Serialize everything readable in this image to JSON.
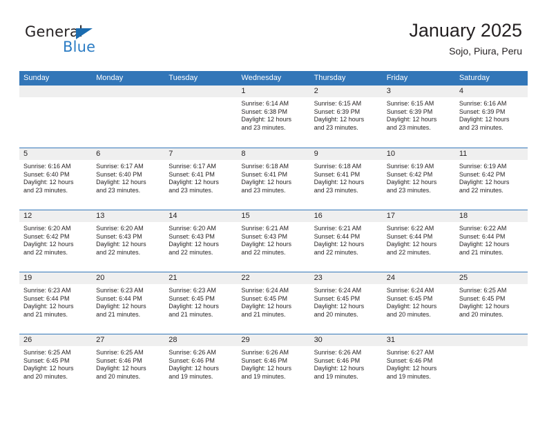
{
  "brand": {
    "name_top": "General",
    "name_bottom": "Blue",
    "accent_color": "#2b7cc4",
    "triangle_color": "#1b6cb0"
  },
  "header": {
    "title": "January 2025",
    "subtitle": "Sojo, Piura, Peru",
    "header_bg": "#3276b8",
    "daynum_bg": "#efefef"
  },
  "weekdays": [
    "Sunday",
    "Monday",
    "Tuesday",
    "Wednesday",
    "Thursday",
    "Friday",
    "Saturday"
  ],
  "weeks": [
    [
      {
        "day": "",
        "sunrise": "",
        "sunset": "",
        "daylight_1": "",
        "daylight_2": ""
      },
      {
        "day": "",
        "sunrise": "",
        "sunset": "",
        "daylight_1": "",
        "daylight_2": ""
      },
      {
        "day": "",
        "sunrise": "",
        "sunset": "",
        "daylight_1": "",
        "daylight_2": ""
      },
      {
        "day": "1",
        "sunrise": "Sunrise: 6:14 AM",
        "sunset": "Sunset: 6:38 PM",
        "daylight_1": "Daylight: 12 hours",
        "daylight_2": "and 23 minutes."
      },
      {
        "day": "2",
        "sunrise": "Sunrise: 6:15 AM",
        "sunset": "Sunset: 6:39 PM",
        "daylight_1": "Daylight: 12 hours",
        "daylight_2": "and 23 minutes."
      },
      {
        "day": "3",
        "sunrise": "Sunrise: 6:15 AM",
        "sunset": "Sunset: 6:39 PM",
        "daylight_1": "Daylight: 12 hours",
        "daylight_2": "and 23 minutes."
      },
      {
        "day": "4",
        "sunrise": "Sunrise: 6:16 AM",
        "sunset": "Sunset: 6:39 PM",
        "daylight_1": "Daylight: 12 hours",
        "daylight_2": "and 23 minutes."
      }
    ],
    [
      {
        "day": "5",
        "sunrise": "Sunrise: 6:16 AM",
        "sunset": "Sunset: 6:40 PM",
        "daylight_1": "Daylight: 12 hours",
        "daylight_2": "and 23 minutes."
      },
      {
        "day": "6",
        "sunrise": "Sunrise: 6:17 AM",
        "sunset": "Sunset: 6:40 PM",
        "daylight_1": "Daylight: 12 hours",
        "daylight_2": "and 23 minutes."
      },
      {
        "day": "7",
        "sunrise": "Sunrise: 6:17 AM",
        "sunset": "Sunset: 6:41 PM",
        "daylight_1": "Daylight: 12 hours",
        "daylight_2": "and 23 minutes."
      },
      {
        "day": "8",
        "sunrise": "Sunrise: 6:18 AM",
        "sunset": "Sunset: 6:41 PM",
        "daylight_1": "Daylight: 12 hours",
        "daylight_2": "and 23 minutes."
      },
      {
        "day": "9",
        "sunrise": "Sunrise: 6:18 AM",
        "sunset": "Sunset: 6:41 PM",
        "daylight_1": "Daylight: 12 hours",
        "daylight_2": "and 23 minutes."
      },
      {
        "day": "10",
        "sunrise": "Sunrise: 6:19 AM",
        "sunset": "Sunset: 6:42 PM",
        "daylight_1": "Daylight: 12 hours",
        "daylight_2": "and 23 minutes."
      },
      {
        "day": "11",
        "sunrise": "Sunrise: 6:19 AM",
        "sunset": "Sunset: 6:42 PM",
        "daylight_1": "Daylight: 12 hours",
        "daylight_2": "and 22 minutes."
      }
    ],
    [
      {
        "day": "12",
        "sunrise": "Sunrise: 6:20 AM",
        "sunset": "Sunset: 6:42 PM",
        "daylight_1": "Daylight: 12 hours",
        "daylight_2": "and 22 minutes."
      },
      {
        "day": "13",
        "sunrise": "Sunrise: 6:20 AM",
        "sunset": "Sunset: 6:43 PM",
        "daylight_1": "Daylight: 12 hours",
        "daylight_2": "and 22 minutes."
      },
      {
        "day": "14",
        "sunrise": "Sunrise: 6:20 AM",
        "sunset": "Sunset: 6:43 PM",
        "daylight_1": "Daylight: 12 hours",
        "daylight_2": "and 22 minutes."
      },
      {
        "day": "15",
        "sunrise": "Sunrise: 6:21 AM",
        "sunset": "Sunset: 6:43 PM",
        "daylight_1": "Daylight: 12 hours",
        "daylight_2": "and 22 minutes."
      },
      {
        "day": "16",
        "sunrise": "Sunrise: 6:21 AM",
        "sunset": "Sunset: 6:44 PM",
        "daylight_1": "Daylight: 12 hours",
        "daylight_2": "and 22 minutes."
      },
      {
        "day": "17",
        "sunrise": "Sunrise: 6:22 AM",
        "sunset": "Sunset: 6:44 PM",
        "daylight_1": "Daylight: 12 hours",
        "daylight_2": "and 22 minutes."
      },
      {
        "day": "18",
        "sunrise": "Sunrise: 6:22 AM",
        "sunset": "Sunset: 6:44 PM",
        "daylight_1": "Daylight: 12 hours",
        "daylight_2": "and 21 minutes."
      }
    ],
    [
      {
        "day": "19",
        "sunrise": "Sunrise: 6:23 AM",
        "sunset": "Sunset: 6:44 PM",
        "daylight_1": "Daylight: 12 hours",
        "daylight_2": "and 21 minutes."
      },
      {
        "day": "20",
        "sunrise": "Sunrise: 6:23 AM",
        "sunset": "Sunset: 6:44 PM",
        "daylight_1": "Daylight: 12 hours",
        "daylight_2": "and 21 minutes."
      },
      {
        "day": "21",
        "sunrise": "Sunrise: 6:23 AM",
        "sunset": "Sunset: 6:45 PM",
        "daylight_1": "Daylight: 12 hours",
        "daylight_2": "and 21 minutes."
      },
      {
        "day": "22",
        "sunrise": "Sunrise: 6:24 AM",
        "sunset": "Sunset: 6:45 PM",
        "daylight_1": "Daylight: 12 hours",
        "daylight_2": "and 21 minutes."
      },
      {
        "day": "23",
        "sunrise": "Sunrise: 6:24 AM",
        "sunset": "Sunset: 6:45 PM",
        "daylight_1": "Daylight: 12 hours",
        "daylight_2": "and 20 minutes."
      },
      {
        "day": "24",
        "sunrise": "Sunrise: 6:24 AM",
        "sunset": "Sunset: 6:45 PM",
        "daylight_1": "Daylight: 12 hours",
        "daylight_2": "and 20 minutes."
      },
      {
        "day": "25",
        "sunrise": "Sunrise: 6:25 AM",
        "sunset": "Sunset: 6:45 PM",
        "daylight_1": "Daylight: 12 hours",
        "daylight_2": "and 20 minutes."
      }
    ],
    [
      {
        "day": "26",
        "sunrise": "Sunrise: 6:25 AM",
        "sunset": "Sunset: 6:45 PM",
        "daylight_1": "Daylight: 12 hours",
        "daylight_2": "and 20 minutes."
      },
      {
        "day": "27",
        "sunrise": "Sunrise: 6:25 AM",
        "sunset": "Sunset: 6:46 PM",
        "daylight_1": "Daylight: 12 hours",
        "daylight_2": "and 20 minutes."
      },
      {
        "day": "28",
        "sunrise": "Sunrise: 6:26 AM",
        "sunset": "Sunset: 6:46 PM",
        "daylight_1": "Daylight: 12 hours",
        "daylight_2": "and 19 minutes."
      },
      {
        "day": "29",
        "sunrise": "Sunrise: 6:26 AM",
        "sunset": "Sunset: 6:46 PM",
        "daylight_1": "Daylight: 12 hours",
        "daylight_2": "and 19 minutes."
      },
      {
        "day": "30",
        "sunrise": "Sunrise: 6:26 AM",
        "sunset": "Sunset: 6:46 PM",
        "daylight_1": "Daylight: 12 hours",
        "daylight_2": "and 19 minutes."
      },
      {
        "day": "31",
        "sunrise": "Sunrise: 6:27 AM",
        "sunset": "Sunset: 6:46 PM",
        "daylight_1": "Daylight: 12 hours",
        "daylight_2": "and 19 minutes."
      },
      {
        "day": "",
        "sunrise": "",
        "sunset": "",
        "daylight_1": "",
        "daylight_2": ""
      }
    ]
  ]
}
